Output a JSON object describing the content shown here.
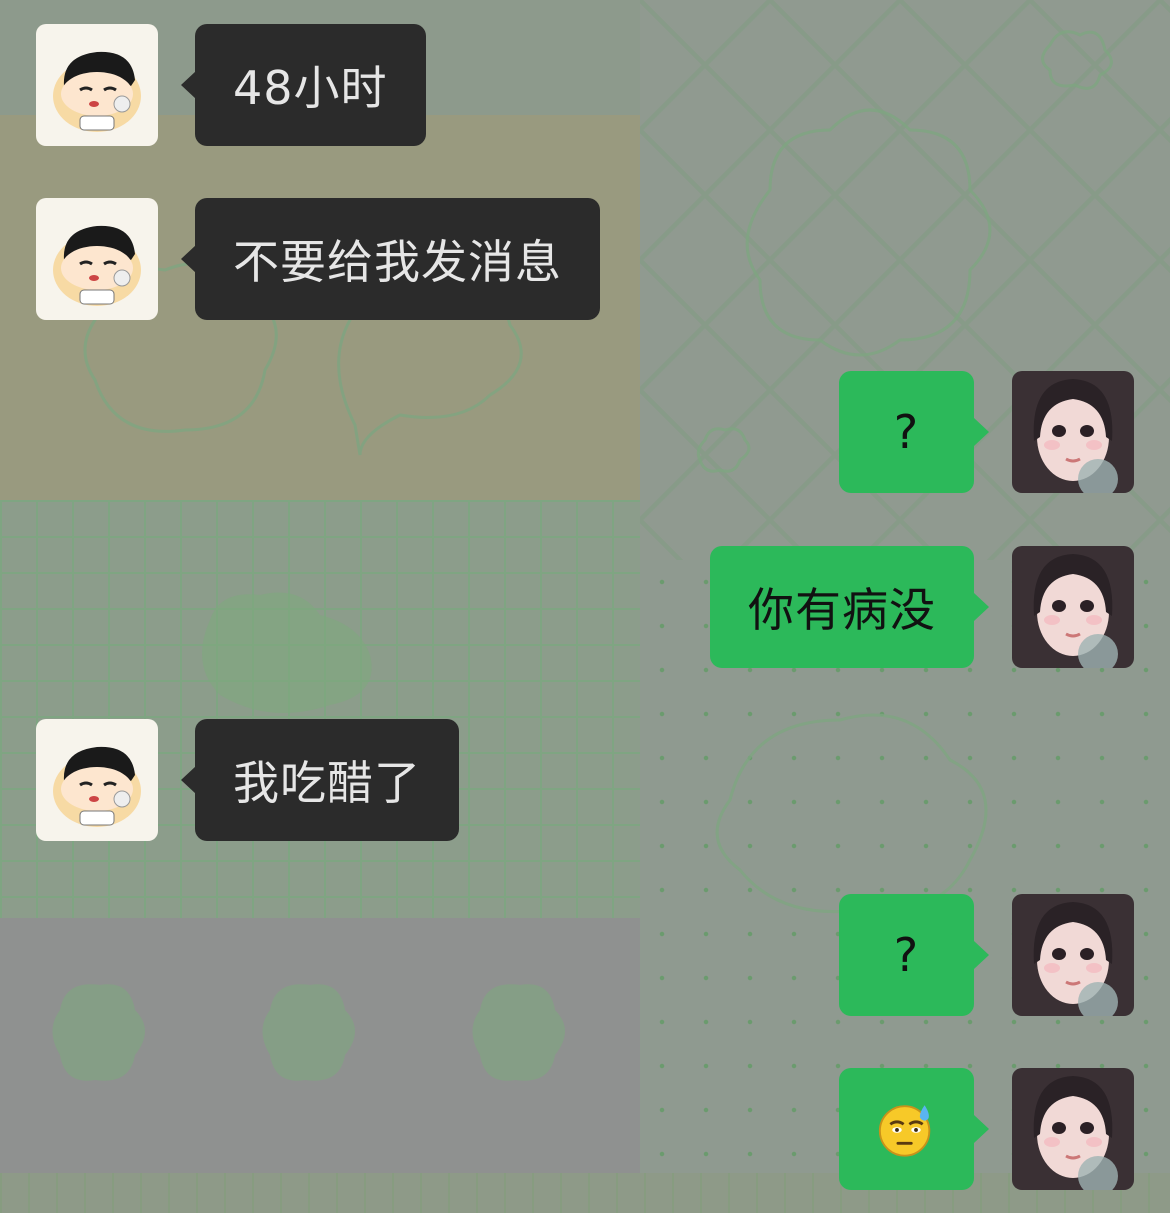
{
  "chat": {
    "messages": [
      {
        "side": "in",
        "type": "text",
        "text": "48小时"
      },
      {
        "side": "in",
        "type": "text",
        "text": "不要给我发消息"
      },
      {
        "side": "out",
        "type": "text",
        "text": "?"
      },
      {
        "side": "out",
        "type": "text",
        "text": "你有病没"
      },
      {
        "side": "in",
        "type": "text",
        "text": "我吃醋了"
      },
      {
        "side": "out",
        "type": "text",
        "text": "?"
      },
      {
        "side": "out",
        "type": "emoji",
        "emoji": "sweat-face-emoji"
      }
    ],
    "contact_avatar": "cartoon-boy-avatar",
    "self_avatar": "girl-photo-avatar",
    "colors": {
      "incoming_bubble": "#2b2b2b",
      "outgoing_bubble": "#2cb95a",
      "incoming_text": "#e6e6e6",
      "outgoing_text": "#111111"
    }
  }
}
